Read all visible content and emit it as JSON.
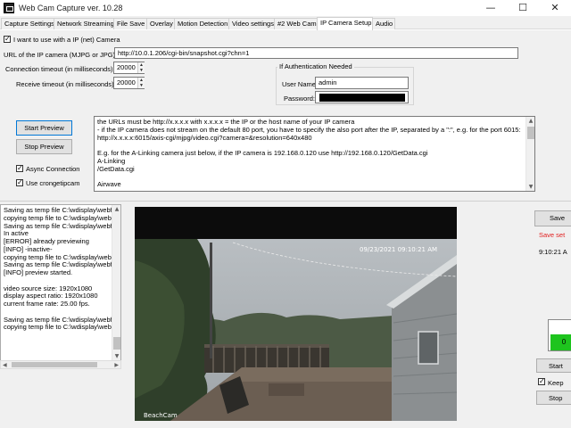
{
  "window": {
    "title": "Web Cam Capture ver. 10.28",
    "minimize": "—",
    "maximize": "☐",
    "close": "✕"
  },
  "tabs": [
    {
      "label": "Capture Settings"
    },
    {
      "label": "Network Streaming"
    },
    {
      "label": "File Save"
    },
    {
      "label": "Overlay"
    },
    {
      "label": "Motion Detection"
    },
    {
      "label": "Video settings"
    },
    {
      "label": "#2 Web Cam"
    },
    {
      "label": "IP Camera Setup"
    },
    {
      "label": "Audio"
    }
  ],
  "ipcam": {
    "use_ip_label": "I want to use with a IP (net) Camera",
    "use_ip_checked": "✓",
    "url_label": "URL of the IP camera (MJPG or JPG):",
    "url_value": "http://10.0.1.206/cgi-bin/snapshot.cgi?chn=1",
    "conn_timeout_label": "Connection timeout  (in milliseconds):",
    "conn_timeout_value": "20000",
    "recv_timeout_label": "Receive timeout (in milliseconds):",
    "recv_timeout_value": "20000",
    "auth_title": "If Authentication Needed",
    "username_label": "User Name:",
    "username_value": "admin",
    "password_label": "Password:",
    "start_preview": "Start Preview",
    "stop_preview": "Stop Preview",
    "async_label": "Async Connection",
    "async_checked": "✓",
    "curl_label": "Use crongetipcam",
    "curl_checked": "✓",
    "info_text": "the URLs must be http://x.x.x.x with x.x.x.x = the IP or the host name of your IP camera\n- if the IP camera does not stream on the default 80 port, you have to specify the also port after the IP, separated by a \":\", e.g. for the port 6015:\nhttp://x.x.x.x:6015/axis-cgi/mjpg/video.cgi?camera=&resolution=640x480\n\nE.g. for the A-Linking camera just below, if the IP camera is 192.168.0.120 use http://192.168.0.120/GetData.cgi\nA-Linking\n/GetData.cgi\n\nAirwave"
  },
  "log": {
    "text": "Saving as temp file C:\\wdisplay\\webf\ncopying temp file to C:\\wdisplay\\webf\nSaving as temp file C:\\wdisplay\\webf\nIn active\n[ERROR] already previewing\n[INFO] -inactive-\ncopying temp file to C:\\wdisplay\\webf\nSaving as temp file C:\\wdisplay\\webf\n[INFO] preview started.\n\nvideo source size: 1920x1080\ndisplay aspect ratio: 1920x1080\ncurrent frame rate: 25.00 fps.\n\nSaving as temp file C:\\wdisplay\\webf\ncopying temp file to C:\\wdisplay\\webf"
  },
  "video": {
    "timestamp": "09/23/2021 09:10:21 AM",
    "watermark": "BeachCam"
  },
  "right": {
    "save_btn": "Save",
    "save_status": "Save set",
    "time": "9:10:21 A",
    "start_btn": "Start",
    "keep_label": "Keep",
    "keep_checked": "✓",
    "stop_btn": "Stop",
    "led_text": "0"
  },
  "colors": {
    "accent": "#0078d7",
    "error": "#e02020",
    "led": "#1ec41e"
  }
}
